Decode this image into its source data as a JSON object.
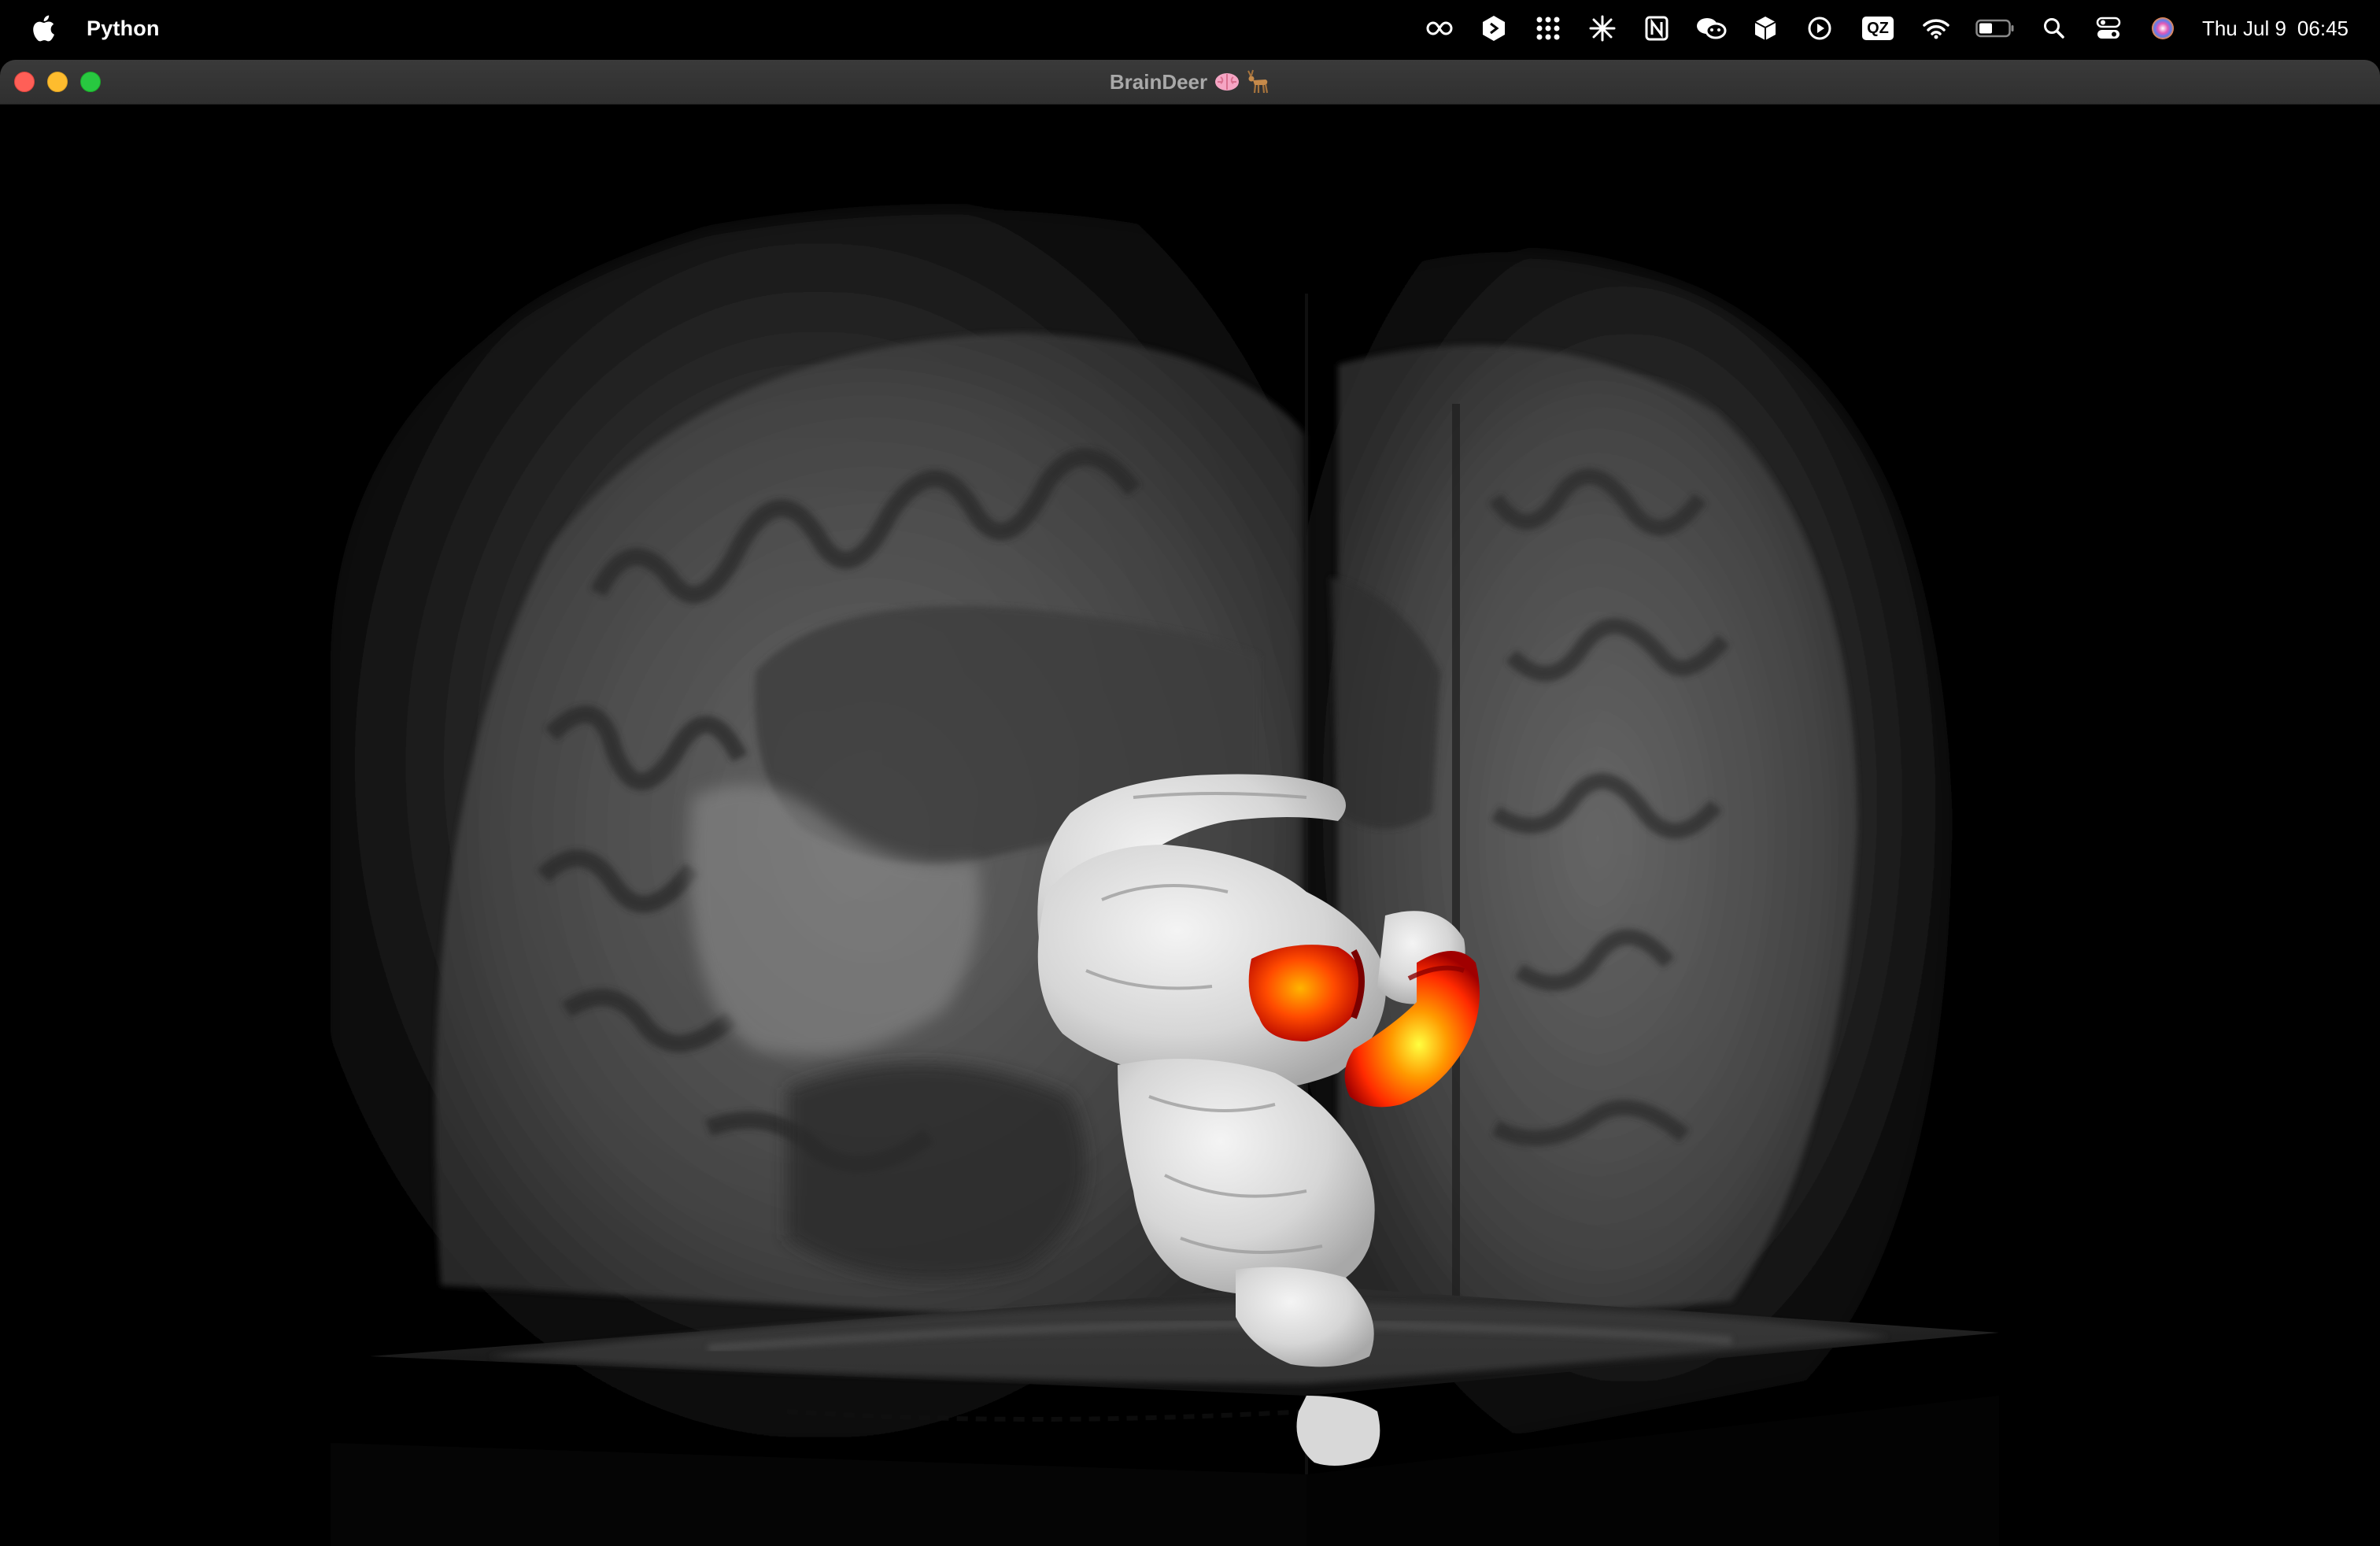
{
  "menubar": {
    "app_name": "Python",
    "status_icons": [
      "creative-cloud-icon",
      "hexagon-app-icon",
      "grid-dots-icon",
      "sparkle-icon",
      "notion-icon",
      "wechat-icon",
      "box-icon",
      "play-icon",
      "qz-icon",
      "wifi-icon",
      "battery-icon",
      "search-icon",
      "control-center-icon",
      "siri-icon"
    ],
    "qz_label": "QZ",
    "day": "Thu Jul 9",
    "time": "06:45"
  },
  "window": {
    "title": "BrainDeer",
    "title_emojis": [
      "brain-icon",
      "deer-icon"
    ]
  },
  "viewport": {
    "scene": "3d-brain-render",
    "overlay_colormap": [
      "#ffff40",
      "#ff8a00",
      "#ff2a00",
      "#a00000"
    ],
    "surface_color": "#dcdcdc"
  }
}
